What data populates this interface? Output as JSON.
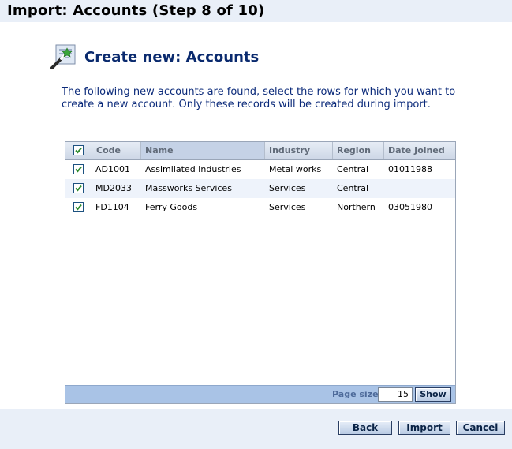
{
  "window": {
    "title": "Import: Accounts (Step 8 of 10)"
  },
  "main": {
    "heading": "Create new: Accounts",
    "icon": "magic-wand-icon",
    "description": "The following new accounts are found, select the rows for which you want to create a new account. Only these records will be created during import."
  },
  "grid": {
    "columns": [
      "Code",
      "Name",
      "Industry",
      "Region",
      "Date Joined"
    ],
    "select_all_checked": true,
    "rows": [
      {
        "checked": true,
        "code": "AD1001",
        "name": "Assimilated Industries",
        "industry": "Metal works",
        "region": "Central",
        "date_joined": "01011988"
      },
      {
        "checked": true,
        "code": "MD2033",
        "name": "Massworks Services",
        "industry": "Services",
        "region": "Central",
        "date_joined": ""
      },
      {
        "checked": true,
        "code": "FD1104",
        "name": "Ferry Goods",
        "industry": "Services",
        "region": "Northern",
        "date_joined": "03051980"
      }
    ],
    "pager": {
      "page_size_label": "Page size",
      "page_size_value": "15",
      "show_label": "Show"
    }
  },
  "footer": {
    "back_label": "Back",
    "import_label": "Import",
    "cancel_label": "Cancel"
  },
  "colors": {
    "accent": "#a9c3e6",
    "title_bg": "#e9eff8",
    "heading": "#0a2a6e",
    "checkbox": "#2e8b2e"
  }
}
